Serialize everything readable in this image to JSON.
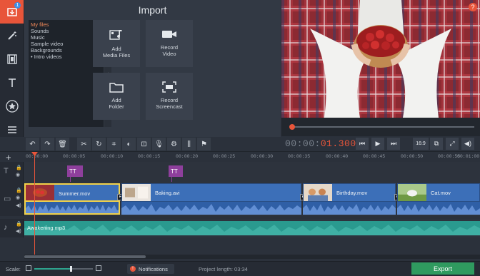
{
  "tools": [
    {
      "name": "import",
      "icon": "film-download-icon",
      "badge": "1"
    },
    {
      "name": "filters",
      "icon": "magic-wand-icon"
    },
    {
      "name": "transitions",
      "icon": "film-strip-icon"
    },
    {
      "name": "titles",
      "icon": "text-t-icon"
    },
    {
      "name": "stickers",
      "icon": "star-icon"
    },
    {
      "name": "more",
      "icon": "menu-list-icon"
    }
  ],
  "import": {
    "title": "Import",
    "folders": [
      "My files",
      "Sounds",
      "Music",
      "Sample video",
      "Backgrounds",
      "Intro videos"
    ],
    "buttons": {
      "add_media": "Add\nMedia Files",
      "record_video": "Record\nVideo",
      "add_folder": "Add\nFolder",
      "record_screencast": "Record\nScreencast"
    }
  },
  "preview": {
    "help": "?",
    "progress": 0.01
  },
  "playback": {
    "timecode_prefix": "00:00:",
    "timecode_current": "01.300",
    "aspect": "16:9"
  },
  "ruler": {
    "add": "+",
    "ticks": [
      "00:00:00",
      "00:00:05",
      "00:00:10",
      "00:00:15",
      "00:00:20",
      "00:00:25",
      "00:00:30",
      "00:00:35",
      "00:00:40",
      "00:00:45",
      "00:00:50",
      "00:00:55",
      "00:01:00"
    ]
  },
  "clips": {
    "text": [
      "TT",
      "TT"
    ],
    "video": [
      "Summer.mov",
      "Baking.avi",
      "Birthday.mov",
      "Cat.mov"
    ],
    "music": "Awakening.mp3"
  },
  "bottom": {
    "scale_label": "Scale:",
    "scale_value": 0.62,
    "notifications": "Notifications",
    "notifications_count": "!",
    "project_length": "Project length:  03:34",
    "export": "Export"
  },
  "colors": {
    "accent": "#e8553a",
    "video_clip": "#3c6fb8",
    "music_clip": "#2a9a8f",
    "text_clip": "#8e3f9c",
    "export": "#2f9a5f"
  }
}
